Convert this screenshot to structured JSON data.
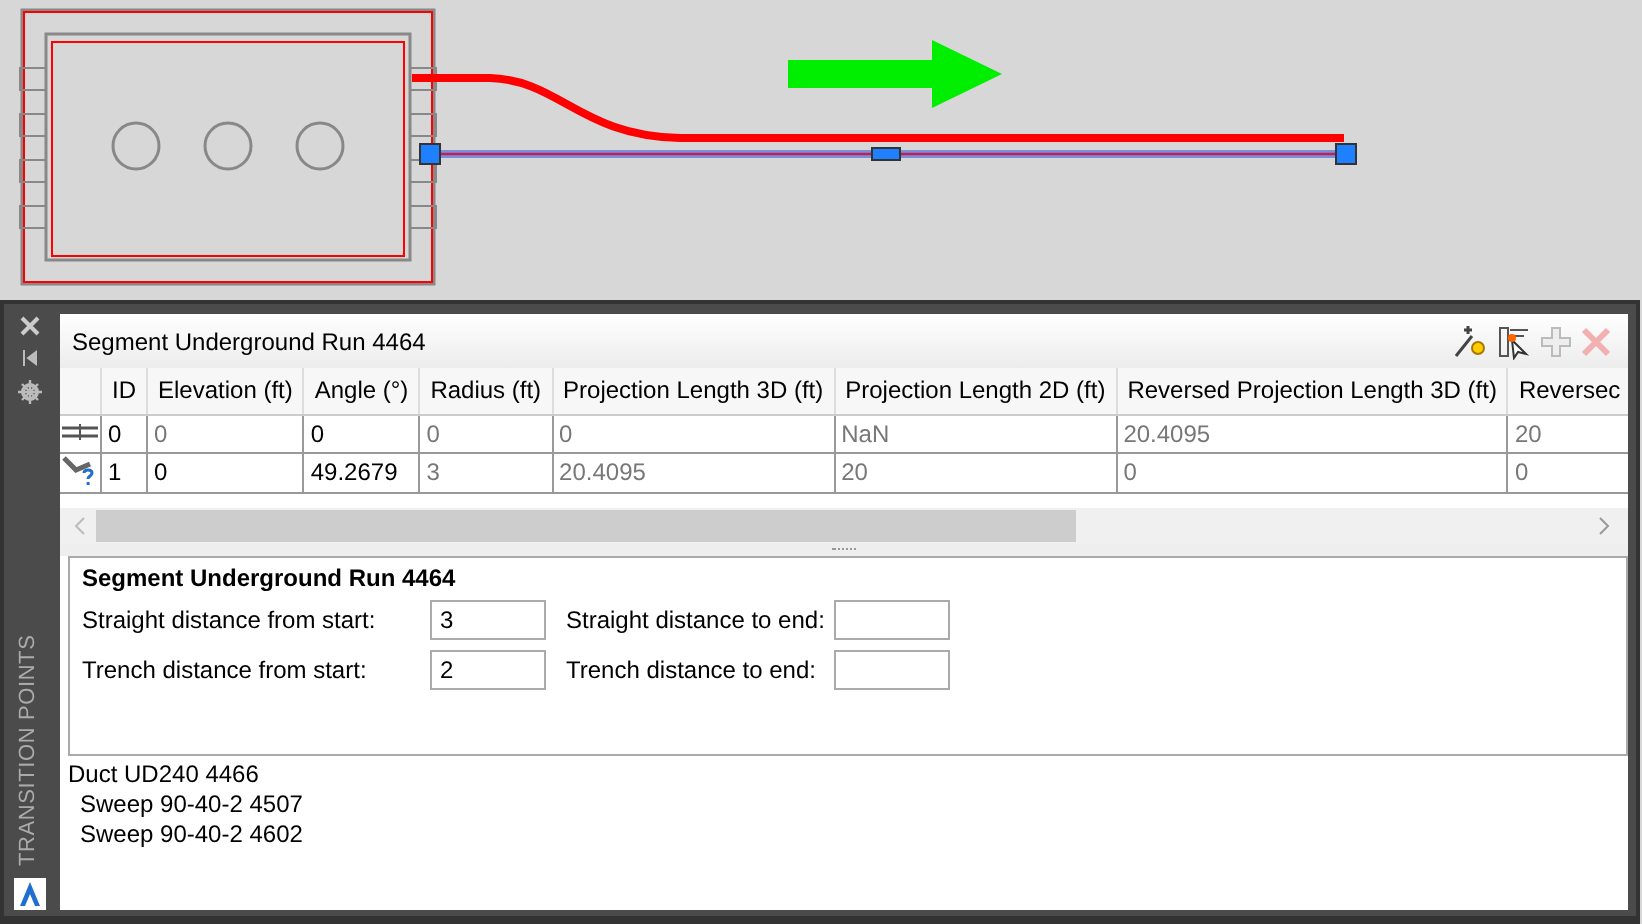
{
  "palette": {
    "side_title": "TRANSITION POINTS"
  },
  "panel": {
    "title": "Segment Underground Run 4464"
  },
  "table": {
    "columns": [
      "ID",
      "Elevation (ft)",
      "Angle (°)",
      "Radius (ft)",
      "Projection Length 3D (ft)",
      "Projection Length 2D (ft)",
      "Reversed Projection Length 3D (ft)",
      "Reversec"
    ],
    "rows": [
      {
        "kind": "straight",
        "cells": [
          "0",
          "0",
          "0",
          "0",
          "0",
          "NaN",
          "20.4095",
          "20"
        ],
        "dim": [
          false,
          true,
          false,
          true,
          true,
          true,
          true,
          true
        ]
      },
      {
        "kind": "bend",
        "cells": [
          "1",
          "0",
          "49.2679",
          "3",
          "20.4095",
          "20",
          "0",
          "0"
        ],
        "dim": [
          false,
          false,
          false,
          true,
          true,
          true,
          true,
          true
        ]
      }
    ]
  },
  "details": {
    "title": "Segment Underground Run 4464",
    "fields": [
      {
        "label": "Straight distance from start:",
        "value": "3"
      },
      {
        "label": "Straight distance to end:"
      },
      {
        "label": "Trench distance from start:",
        "value": "2"
      },
      {
        "label": "Trench distance to end:"
      }
    ]
  },
  "tree": [
    {
      "label": "Duct UD240 4466",
      "children": [
        {
          "label": "Sweep 90-40-2 4507"
        },
        {
          "label": "Sweep 90-40-2 4602"
        }
      ]
    }
  ]
}
